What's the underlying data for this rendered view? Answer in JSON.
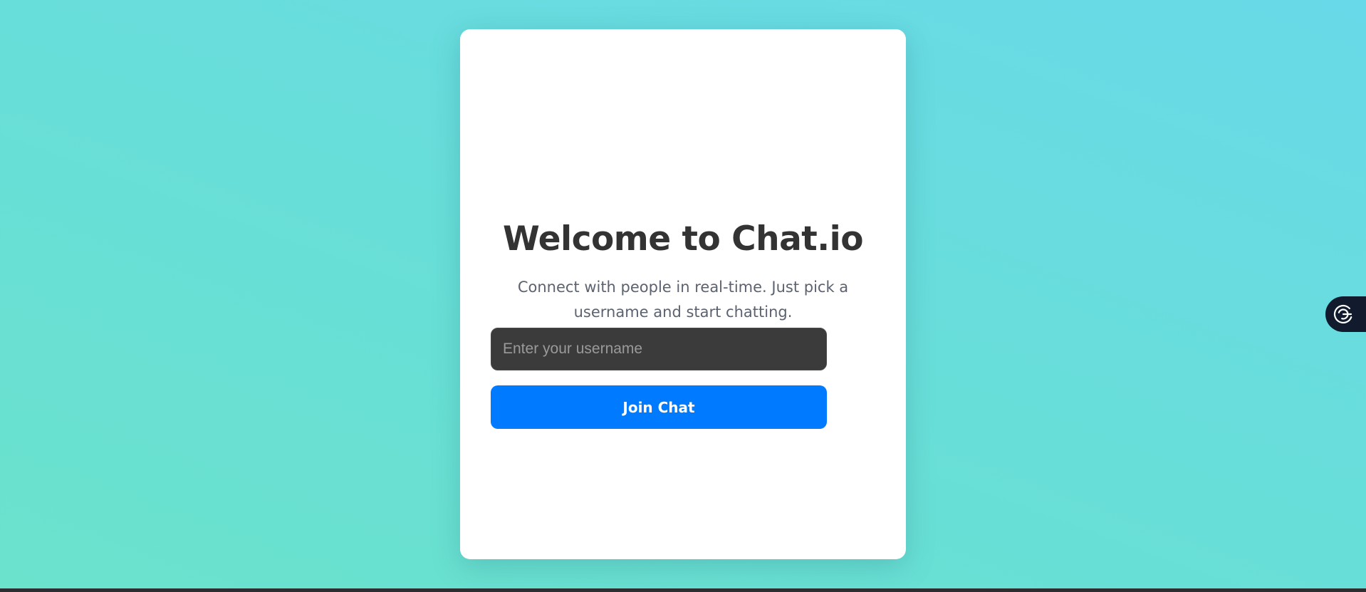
{
  "login_card": {
    "title": "Welcome to Chat.io",
    "subtitle": "Connect with people in real-time. Just pick a username and start chatting.",
    "username_input": {
      "placeholder": "Enter your username",
      "value": ""
    },
    "join_button_label": "Join Chat"
  },
  "side_widget": {
    "icon": "spiral-logo-icon"
  },
  "colors": {
    "background_gradient": [
      "#68d9e8",
      "#6ae2cc"
    ],
    "card": "#ffffff",
    "title_text": "#333333",
    "subtitle_text": "#5c6270",
    "input_background": "#3b3b3b",
    "button_accent": "#007bff",
    "widget_background": "#111b2d"
  }
}
